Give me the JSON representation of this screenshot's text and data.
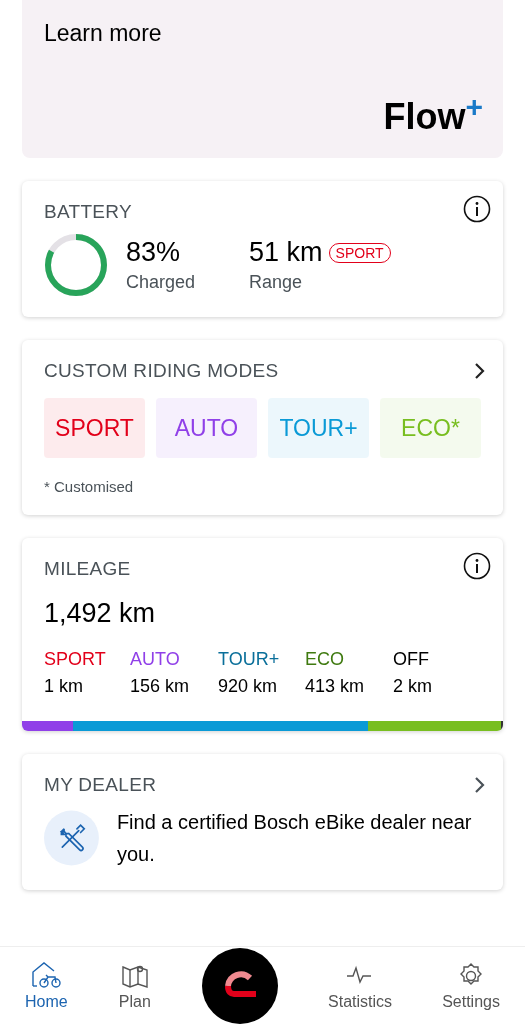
{
  "promo": {
    "link": "Learn more",
    "logo": "Flow",
    "logo_mark": "+"
  },
  "battery": {
    "title": "BATTERY",
    "charge": "83%",
    "charge_label": "Charged",
    "range": "51 km",
    "range_mode": "SPORT",
    "range_label": "Range"
  },
  "riding_modes": {
    "title": "CUSTOM RIDING MODES",
    "modes": [
      {
        "label": "SPORT",
        "color": "#e2001a"
      },
      {
        "label": "AUTO",
        "color": "#9040e8"
      },
      {
        "label": "TOUR+",
        "color": "#0a9ad6"
      },
      {
        "label": "ECO*",
        "color": "#78be20"
      }
    ],
    "footnote": "* Customised"
  },
  "mileage": {
    "title": "MILEAGE",
    "total": "1,492 km",
    "modes": [
      {
        "label": "SPORT",
        "distance": "1 km",
        "color": "#e2001a"
      },
      {
        "label": "AUTO",
        "distance": "156 km",
        "color": "#9040e8"
      },
      {
        "label": "TOUR+",
        "distance": "920 km",
        "color": "#0a6f9a"
      },
      {
        "label": "ECO",
        "distance": "413 km",
        "color": "#3f7a10"
      },
      {
        "label": "OFF",
        "distance": "2 km",
        "color": "#000000"
      }
    ],
    "bar_segments": [
      {
        "color": "#9040e8"
      },
      {
        "color": "#0a9ad6"
      },
      {
        "color": "#78be20"
      },
      {
        "color": "#333333"
      }
    ]
  },
  "dealer": {
    "title": "MY DEALER",
    "text": "Find a certified Bosch eBike dealer near you."
  },
  "nav": [
    {
      "label": "Home",
      "kind": "home",
      "selected": true
    },
    {
      "label": "Plan",
      "kind": "plan",
      "selected": false
    },
    {
      "kind": "center"
    },
    {
      "label": "Statistics",
      "kind": "statistics",
      "selected": false
    },
    {
      "label": "Settings",
      "kind": "settings",
      "selected": false
    }
  ]
}
